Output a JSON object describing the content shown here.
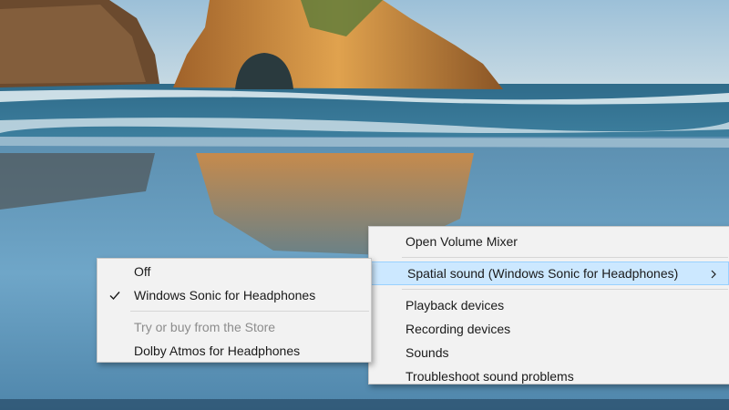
{
  "context_menu": {
    "items": [
      {
        "label": "Open Volume Mixer"
      },
      {
        "label": "Spatial sound (Windows Sonic for Headphones)",
        "highlighted": true,
        "has_submenu": true
      },
      {
        "label": "Playback devices"
      },
      {
        "label": "Recording devices"
      },
      {
        "label": "Sounds"
      },
      {
        "label": "Troubleshoot sound problems"
      }
    ]
  },
  "spatial_submenu": {
    "items": [
      {
        "label": "Off"
      },
      {
        "label": "Windows Sonic for Headphones",
        "checked": true
      },
      {
        "label": "Try or buy from the Store",
        "disabled": true
      },
      {
        "label": "Dolby Atmos for Headphones"
      }
    ]
  },
  "colors": {
    "menu_background": "#f2f2f2",
    "highlight_background": "#cce8ff",
    "highlight_border": "#99d1ff",
    "disabled_text": "#8c8c8c"
  },
  "icons": {
    "check": "check-icon",
    "submenu": "chevron-right-icon"
  }
}
